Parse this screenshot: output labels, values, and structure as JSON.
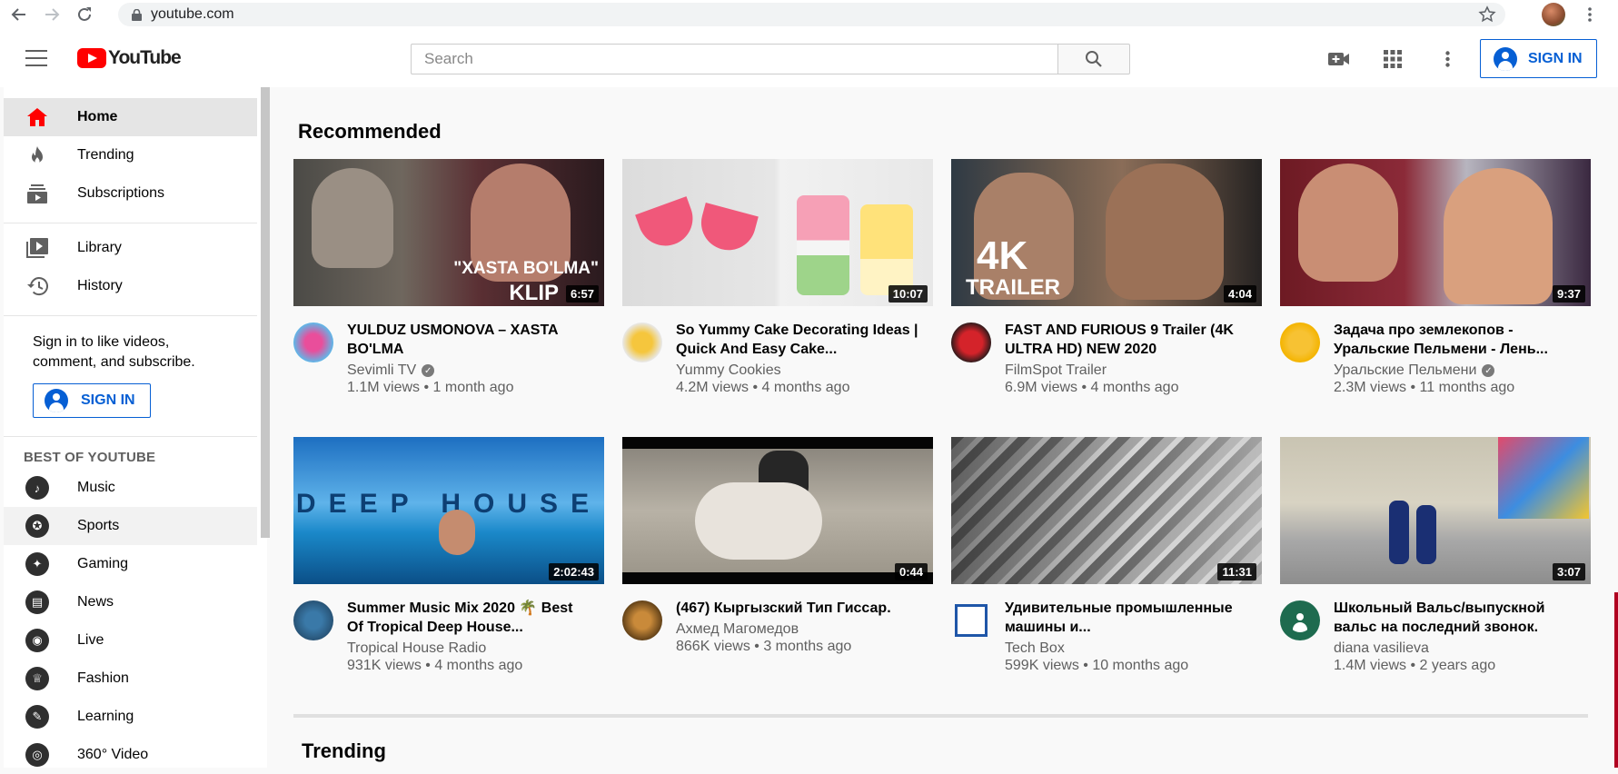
{
  "browser": {
    "url": "youtube.com"
  },
  "masthead": {
    "logo_text": "YouTube",
    "search_placeholder": "Search",
    "signin_label": "SIGN IN"
  },
  "sidebar": {
    "primary": [
      {
        "label": "Home",
        "icon": "home-icon"
      },
      {
        "label": "Trending",
        "icon": "flame-icon"
      },
      {
        "label": "Subscriptions",
        "icon": "subscriptions-icon"
      }
    ],
    "secondary": [
      {
        "label": "Library",
        "icon": "library-icon"
      },
      {
        "label": "History",
        "icon": "history-icon"
      }
    ],
    "signin_message": "Sign in to like videos, comment, and subscribe.",
    "signin_label": "SIGN IN",
    "best_heading": "BEST OF YOUTUBE",
    "best": [
      {
        "label": "Music",
        "icon": "music-icon"
      },
      {
        "label": "Sports",
        "icon": "sports-icon"
      },
      {
        "label": "Gaming",
        "icon": "gaming-icon"
      },
      {
        "label": "News",
        "icon": "news-icon"
      },
      {
        "label": "Live",
        "icon": "live-icon"
      },
      {
        "label": "Fashion",
        "icon": "fashion-icon"
      },
      {
        "label": "Learning",
        "icon": "learning-icon"
      },
      {
        "label": "360° Video",
        "icon": "vr-icon"
      }
    ]
  },
  "sections": {
    "recommended": "Recommended",
    "trending": "Trending"
  },
  "videos": [
    {
      "title": "YULDUZ USMONOVA – XASTA BO'LMA",
      "channel": "Sevimli TV",
      "verified": true,
      "meta": "1.1M views • 1 month ago",
      "duration": "6:57",
      "thumb_text_1": "\"XASTA BO'LMA\"",
      "thumb_text_2": "KLIP"
    },
    {
      "title": "So Yummy Cake Decorating Ideas | Quick And Easy Cake...",
      "channel": "Yummy Cookies",
      "verified": false,
      "meta": "4.2M views • 4 months ago",
      "duration": "10:07"
    },
    {
      "title": "FAST AND FURIOUS 9 Trailer (4K ULTRA HD) NEW 2020",
      "channel": "FilmSpot Trailer",
      "verified": false,
      "meta": "6.9M views • 4 months ago",
      "duration": "4:04",
      "thumb_text_1": "4K",
      "thumb_text_2": "TRAILER"
    },
    {
      "title": "Задача про землекопов - Уральские Пельмени - Лень...",
      "channel": "Уральские Пельмени",
      "verified": true,
      "meta": "2.3M views • 11 months ago",
      "duration": "9:37"
    },
    {
      "title": "Summer Music Mix 2020 🌴 Best Of Tropical Deep House...",
      "channel": "Tropical House Radio",
      "verified": false,
      "meta": "931K views • 4 months ago",
      "duration": "2:02:43",
      "thumb_text_1": "DEEP HOUSE"
    },
    {
      "title": "(467) Кыргызский Тип Гиссар.",
      "channel": "Ахмед Магомедов",
      "verified": false,
      "meta": "866K views • 3 months ago",
      "duration": "0:44"
    },
    {
      "title": "Удивительные промышленные машины и...",
      "channel": "Tech Box",
      "verified": false,
      "meta": "599K views • 10 months ago",
      "duration": "11:31"
    },
    {
      "title": "Школьный Вальс/выпускной вальс на последний звонок.",
      "channel": "diana vasilieva",
      "verified": false,
      "meta": "1.4M views • 2 years ago",
      "duration": "3:07"
    }
  ],
  "colors": {
    "brand_red": "#ff0000",
    "link_blue": "#065fd4",
    "text_secondary": "#606060"
  }
}
